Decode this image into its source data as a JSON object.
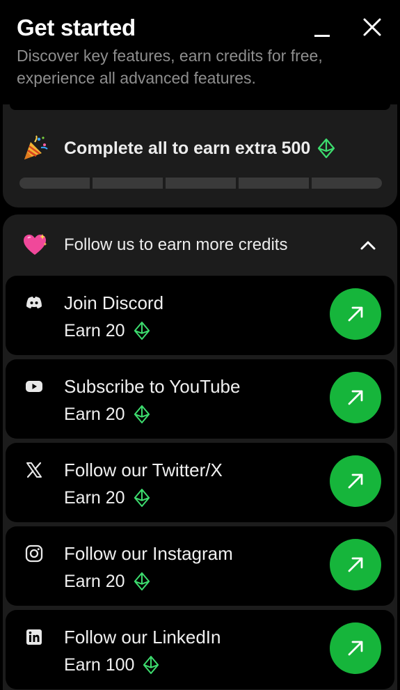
{
  "header": {
    "title": "Get started",
    "subtitle": "Discover key features, earn credits for free, experience all advanced features."
  },
  "summary": {
    "text": "Complete all to earn extra 500",
    "icon": "party-popper-icon",
    "progress_segments_total": 5,
    "progress_segments_completed": 0
  },
  "section": {
    "label": "Follow us to earn more credits",
    "icon": "sparkling-heart-icon",
    "expanded": true
  },
  "tasks": [
    {
      "icon": "discord-icon",
      "title": "Join Discord",
      "earn": "Earn 20"
    },
    {
      "icon": "youtube-icon",
      "title": "Subscribe to YouTube",
      "earn": "Earn 20"
    },
    {
      "icon": "x-twitter-icon",
      "title": "Follow our Twitter/X",
      "earn": "Earn 20"
    },
    {
      "icon": "instagram-icon",
      "title": "Follow our Instagram",
      "earn": "Earn 20"
    },
    {
      "icon": "linkedin-icon",
      "title": "Follow our LinkedIn",
      "earn": "Earn 100"
    }
  ],
  "colors": {
    "background": "#000000",
    "panel": "#1c1c1c",
    "accent_green": "#16b53b",
    "credit_green": "#3ddc6e",
    "muted_text": "#8e8e8e",
    "progress_track": "#3a3a3a"
  }
}
